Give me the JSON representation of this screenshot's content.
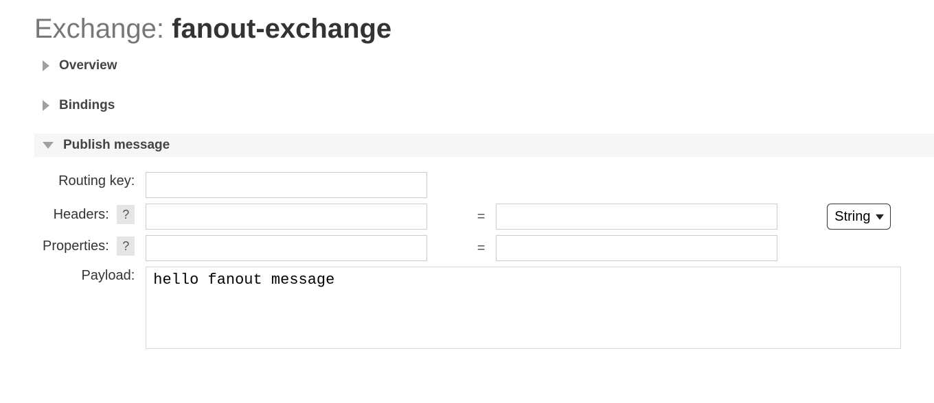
{
  "page": {
    "title_prefix": "Exchange: ",
    "title_name": "fanout-exchange"
  },
  "sections": {
    "overview": {
      "label": "Overview"
    },
    "bindings": {
      "label": "Bindings"
    },
    "publish": {
      "label": "Publish message"
    }
  },
  "form": {
    "routing_key": {
      "label": "Routing key:",
      "value": ""
    },
    "headers": {
      "label": "Headers:",
      "help": "?",
      "key": "",
      "equals": "=",
      "value": "",
      "type_selected": "String",
      "type_options": [
        "String"
      ]
    },
    "properties": {
      "label": "Properties:",
      "help": "?",
      "key": "",
      "equals": "=",
      "value": ""
    },
    "payload": {
      "label": "Payload:",
      "value": "hello fanout message"
    }
  }
}
